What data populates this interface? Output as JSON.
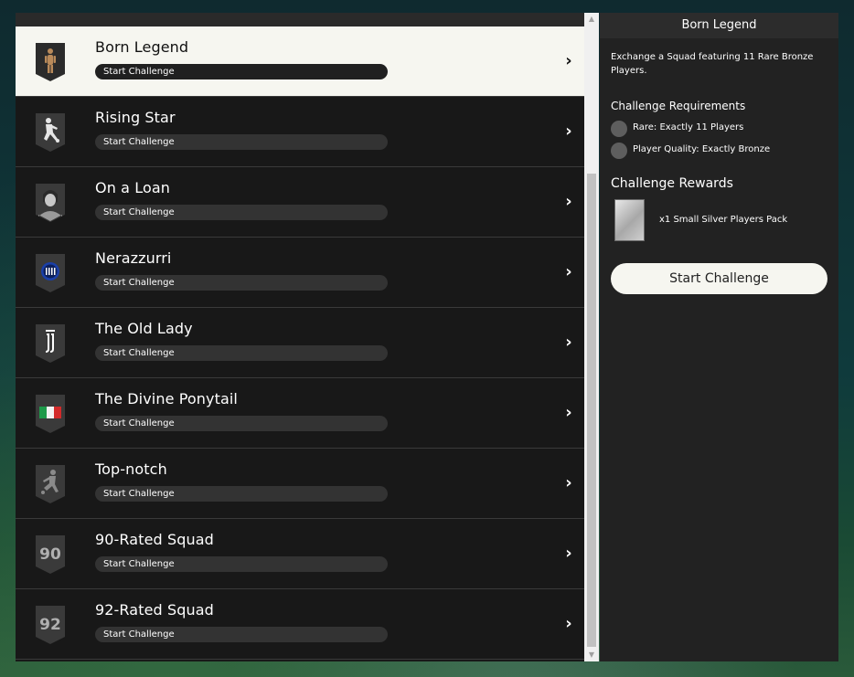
{
  "challenges": [
    {
      "title": "Born Legend",
      "button": "Start Challenge",
      "selected": true,
      "icon": "born-legend-player-icon"
    },
    {
      "title": "Rising Star",
      "button": "Start Challenge",
      "selected": false,
      "icon": "rising-star-player-icon"
    },
    {
      "title": "On a Loan",
      "button": "Start Challenge",
      "selected": false,
      "icon": "on-a-loan-portrait-icon"
    },
    {
      "title": "Nerazzurri",
      "button": "Start Challenge",
      "selected": false,
      "icon": "inter-crest-icon"
    },
    {
      "title": "The Old Lady",
      "button": "Start Challenge",
      "selected": false,
      "icon": "juventus-crest-icon"
    },
    {
      "title": "The Divine Ponytail",
      "button": "Start Challenge",
      "selected": false,
      "icon": "italy-flag-icon"
    },
    {
      "title": "Top-notch",
      "button": "Start Challenge",
      "selected": false,
      "icon": "kicking-player-icon"
    },
    {
      "title": "90-Rated Squad",
      "button": "Start Challenge",
      "selected": false,
      "icon": "rating-90-icon",
      "rating": "90"
    },
    {
      "title": "92-Rated Squad",
      "button": "Start Challenge",
      "selected": false,
      "icon": "rating-92-icon",
      "rating": "92"
    }
  ],
  "detail": {
    "header": "Born Legend",
    "description": "Exchange a Squad featuring 11 Rare Bronze Players.",
    "requirements_title": "Challenge Requirements",
    "requirements": [
      "Rare: Exactly 11 Players",
      "Player Quality: Exactly Bronze"
    ],
    "rewards_title": "Challenge Rewards",
    "reward": "x1 Small Silver Players Pack",
    "start_button": "Start Challenge"
  },
  "colors": {
    "panel_bg": "#181818",
    "selected_bg": "#f6f6f0",
    "button_bg": "#333333",
    "detail_bg": "#222222"
  }
}
